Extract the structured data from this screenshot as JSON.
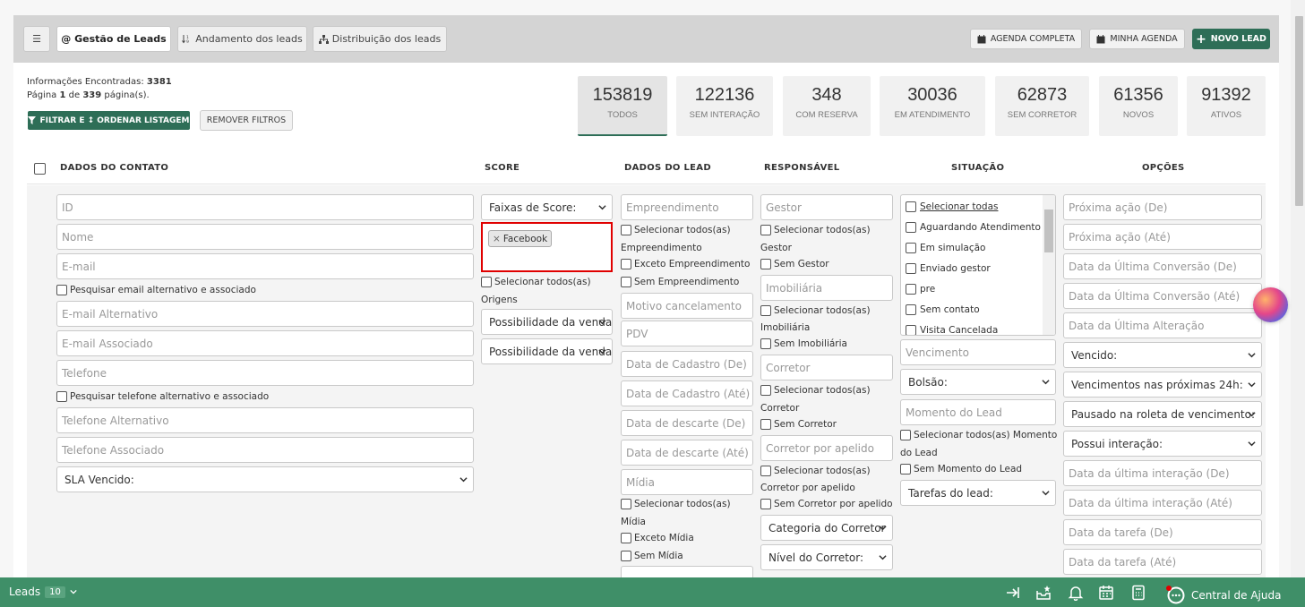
{
  "tabs": {
    "menu_label": "☰",
    "gestao": "@ Gestão de Leads",
    "andamento": "Andamento dos leads",
    "distribuicao": "Distribuição dos leads"
  },
  "actions": {
    "agenda_completa": "AGENDA COMPLETA",
    "minha_agenda": "MINHA AGENDA",
    "novo_lead": "NOVO LEAD"
  },
  "info": {
    "found_label": "Informações Encontradas:",
    "found_count": "3381",
    "page_label": "Página",
    "page_current": "1",
    "page_of": "de",
    "page_total": "339",
    "page_suffix": "página(s).",
    "filter_button": "FILTRAR E ↕ ORDENAR LISTAGEM",
    "remove_filters": "REMOVER FILTROS"
  },
  "stats": [
    {
      "num": "153819",
      "label": "TODOS"
    },
    {
      "num": "122136",
      "label": "SEM INTERAÇÃO"
    },
    {
      "num": "348",
      "label": "COM RESERVA"
    },
    {
      "num": "30036",
      "label": "EM ATENDIMENTO"
    },
    {
      "num": "62873",
      "label": "SEM CORRETOR"
    },
    {
      "num": "61356",
      "label": "NOVOS"
    },
    {
      "num": "91392",
      "label": "ATIVOS"
    }
  ],
  "headers": {
    "contato": "DADOS DO CONTATO",
    "score": "SCORE",
    "lead": "DADOS DO LEAD",
    "responsavel": "RESPONSÁVEL",
    "situacao": "SITUAÇÃO",
    "opcoes": "OPÇÕES"
  },
  "contato": {
    "id": "ID",
    "nome": "Nome",
    "email": "E-mail",
    "email_cb": "Pesquisar email alternativo e associado",
    "email_alt": "E-mail Alternativo",
    "email_assoc": "E-mail Associado",
    "telefone": "Telefone",
    "tel_cb": "Pesquisar telefone alternativo e associado",
    "tel_alt": "Telefone Alternativo",
    "tel_assoc": "Telefone Associado",
    "sla": "SLA Vencido:"
  },
  "score": {
    "faixas": "Faixas de Score:",
    "tag": "Facebook",
    "tag_remove": "×",
    "sel_todos": "Selecionar todos(as)",
    "origens": "Origens",
    "possibilidade1": "Possibilidade da venda",
    "possibilidade2": "Possibilidade da venda"
  },
  "lead": {
    "empreendimento": "Empreendimento",
    "sel_todos_emp": "Selecionar todos(as)",
    "emp_label": "Empreendimento",
    "exceto_emp": "Exceto Empreendimento",
    "sem_emp": "Sem Empreendimento",
    "motivo": "Motivo cancelamento",
    "pdv": "PDV",
    "cad_de": "Data de Cadastro (De)",
    "cad_ate": "Data de Cadastro (Até)",
    "desc_de": "Data de descarte (De)",
    "desc_ate": "Data de descarte (Até)",
    "midia": "Mídia",
    "sel_todos_midia": "Selecionar todos(as)",
    "midia_label": "Mídia",
    "exceto_midia": "Exceto Mídia",
    "sem_midia": "Sem Mídia"
  },
  "responsavel": {
    "gestor": "Gestor",
    "sel_todos_gestor": "Selecionar todos(as)",
    "gestor_label": "Gestor",
    "sem_gestor": "Sem Gestor",
    "imobiliaria": "Imobiliária",
    "sel_todos_imob": "Selecionar todos(as)",
    "imob_label": "Imobiliária",
    "sem_imob": "Sem Imobiliária",
    "corretor": "Corretor",
    "sel_todos_corretor": "Selecionar todos(as)",
    "corretor_label": "Corretor",
    "sem_corretor": "Sem Corretor",
    "apelido": "Corretor por apelido",
    "sel_todos_apelido": "Selecionar todos(as)",
    "apelido_label": "Corretor por apelido",
    "sem_apelido": "Sem Corretor por apelido",
    "categoria": "Categoria do Corretor",
    "nivel": "Nível do Corretor:"
  },
  "situacao": {
    "items": [
      "Selecionar todas",
      "Aguardando Atendimento",
      "Em simulação",
      "Enviado gestor",
      "pre",
      "Sem contato",
      "Visita Cancelada"
    ],
    "vencimento": "Vencimento",
    "bolsao": "Bolsão:",
    "momento": "Momento do Lead",
    "sel_todos_momento": "Selecionar todos(as) Momento",
    "momento_label": "do Lead",
    "sem_momento": "Sem Momento do Lead",
    "tarefas": "Tarefas do lead:"
  },
  "opcoes": {
    "proxima_de": "Próxima ação (De)",
    "proxima_ate": "Próxima ação (Até)",
    "conv_de": "Data da Última Conversão (De)",
    "conv_ate": "Data da Última Conversão (Até)",
    "alteracao": "Data da Última Alteração",
    "vencido": "Vencido:",
    "venc24": "Vencimentos nas próximas 24h:",
    "pausado": "Pausado na roleta de vencimento:",
    "interacao": "Possui interação:",
    "int_de": "Data da última interação (De)",
    "int_ate": "Data da última interação (Até)",
    "tarefa_de": "Data da tarefa (De)",
    "tarefa_ate": "Data da tarefa (Até)"
  },
  "bottom": {
    "leads": "Leads",
    "count": "10",
    "help": "Central de Ajuda"
  },
  "colors": {
    "primary_green": "#2e6e57",
    "bar_green": "#3f8f68",
    "highlight_red": "#e00000"
  }
}
